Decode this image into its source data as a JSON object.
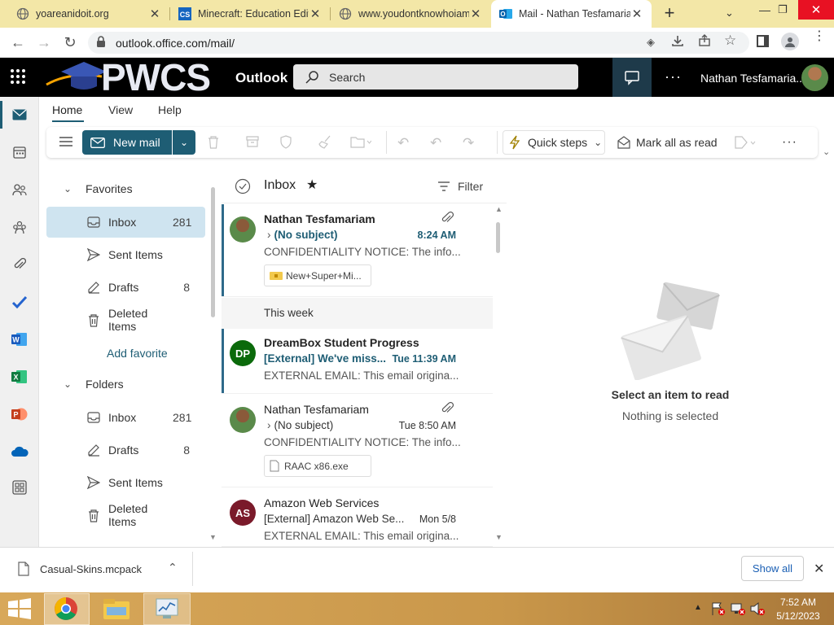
{
  "browser": {
    "tabs": [
      {
        "title": "yoareanidoit.org",
        "icon": "globe-icon"
      },
      {
        "title": "Minecraft: Education Edition",
        "icon": "cs-icon"
      },
      {
        "title": "www.youdontknowhoiam",
        "icon": "globe-icon"
      },
      {
        "title": "Mail - Nathan Tesfamariam",
        "icon": "outlook-icon"
      }
    ],
    "url": "outlook.office.com/mail/"
  },
  "header": {
    "brand": "PWCS",
    "app_name": "Outlook",
    "search_placeholder": "Search",
    "user_name": "Nathan Tesfamaria..."
  },
  "ribbon": {
    "tabs": [
      "Home",
      "View",
      "Help"
    ],
    "new_mail": "New mail",
    "quick_steps": "Quick steps",
    "mark_all_read": "Mark all as read"
  },
  "folders": {
    "favorites_label": "Favorites",
    "favorites": [
      {
        "name": "Inbox",
        "count": "281"
      },
      {
        "name": "Sent Items",
        "count": ""
      },
      {
        "name": "Drafts",
        "count": "8"
      },
      {
        "name": "Deleted Items",
        "count": ""
      }
    ],
    "add_favorite": "Add favorite",
    "folders_label": "Folders",
    "folders": [
      {
        "name": "Inbox",
        "count": "281"
      },
      {
        "name": "Drafts",
        "count": "8"
      },
      {
        "name": "Sent Items",
        "count": ""
      },
      {
        "name": "Deleted Items",
        "count": ""
      }
    ]
  },
  "list": {
    "title": "Inbox",
    "filter": "Filter",
    "group_this_week": "This week",
    "messages": [
      {
        "sender": "Nathan Tesfamariam",
        "subject": "(No subject)",
        "time": "8:24 AM",
        "preview": "CONFIDENTIALITY NOTICE: The info...",
        "attachment": "New+Super+Mi..."
      },
      {
        "sender": "DreamBox Student Progress",
        "subject": "[External] We've miss...",
        "time": "Tue 11:39 AM",
        "preview": "EXTERNAL EMAIL: This email origina...",
        "initials": "DP"
      },
      {
        "sender": "Nathan Tesfamariam",
        "subject": "(No subject)",
        "time": "Tue 8:50 AM",
        "preview": "CONFIDENTIALITY NOTICE: The info...",
        "attachment": "RAAC x86.exe"
      },
      {
        "sender": "Amazon Web Services",
        "subject": "[External] Amazon Web Se...",
        "time": "Mon 5/8",
        "preview": "EXTERNAL EMAIL: This email origina...",
        "initials": "AS"
      }
    ]
  },
  "reading": {
    "title": "Select an item to read",
    "subtitle": "Nothing is selected"
  },
  "download": {
    "file": "Casual-Skins.mcpack",
    "show_all": "Show all"
  },
  "taskbar": {
    "time": "7:52 AM",
    "date": "5/12/2023"
  },
  "colors": {
    "accent": "#1e5d74",
    "tabstrip": "#f3e7a7",
    "selected_folder": "#cfe4f0",
    "dp_avatar": "#0b6a0b",
    "as_avatar": "#7a1a2a"
  }
}
